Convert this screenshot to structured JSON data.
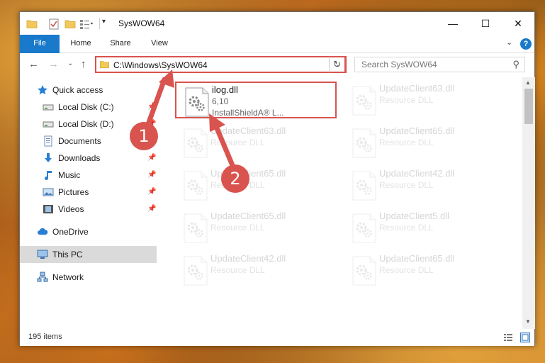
{
  "window": {
    "title": "SysWOW64",
    "controls": {
      "minimize": "—",
      "maximize": "☐",
      "close": "✕"
    }
  },
  "ribbon": {
    "tabs": [
      "File",
      "Home",
      "Share",
      "View"
    ],
    "expand_icon": "chevron-down-icon",
    "help_icon": "?"
  },
  "nav": {
    "address": "C:\\Windows\\SysWOW64",
    "search_placeholder": "Search SysWOW64"
  },
  "sidebar": {
    "items": [
      {
        "label": "Quick access",
        "icon": "star-icon",
        "pinned": false
      },
      {
        "label": "Local Disk (C:)",
        "icon": "drive-icon",
        "pinned": true
      },
      {
        "label": "Local Disk (D:)",
        "icon": "drive-icon",
        "pinned": true
      },
      {
        "label": "Documents",
        "icon": "documents-icon",
        "pinned": true
      },
      {
        "label": "Downloads",
        "icon": "download-icon",
        "pinned": true
      },
      {
        "label": "Music",
        "icon": "music-icon",
        "pinned": true
      },
      {
        "label": "Pictures",
        "icon": "pictures-icon",
        "pinned": true
      },
      {
        "label": "Videos",
        "icon": "videos-icon",
        "pinned": true
      },
      {
        "label": "OneDrive",
        "icon": "cloud-icon",
        "pinned": false
      },
      {
        "label": "This PC",
        "icon": "computer-icon",
        "pinned": false,
        "selected": true
      },
      {
        "label": "Network",
        "icon": "network-icon",
        "pinned": false
      }
    ]
  },
  "files": [
    {
      "name": "ilog.dll",
      "line2": "6,10",
      "line3": "InstallShieldA® L...",
      "highlighted": true
    },
    {
      "name": "UpdateClient63.dll",
      "line2": "Resource DLL"
    },
    {
      "name": "UpdateClient63.dll",
      "line2": "Resource DLL"
    },
    {
      "name": "UpdateClient65.dll",
      "line2": "Resource DLL"
    },
    {
      "name": "UpdateClient65.dll",
      "line2": "Resource DLL"
    },
    {
      "name": "UpdateClient42.dll",
      "line2": "Resource DLL"
    },
    {
      "name": "UpdateClient65.dll",
      "line2": "Resource DLL"
    },
    {
      "name": "UpdateClient5.dll",
      "line2": "Resource DLL"
    },
    {
      "name": "UpdateClient42.dll",
      "line2": "Resource DLL"
    },
    {
      "name": "UpdateClient65.dll",
      "line2": "Resource DLL"
    }
  ],
  "status": {
    "item_count": "195 items"
  },
  "callouts": [
    "1",
    "2"
  ],
  "colors": {
    "accent": "#1979ca",
    "highlight": "#d9534f",
    "selected_bg": "#dadada"
  }
}
